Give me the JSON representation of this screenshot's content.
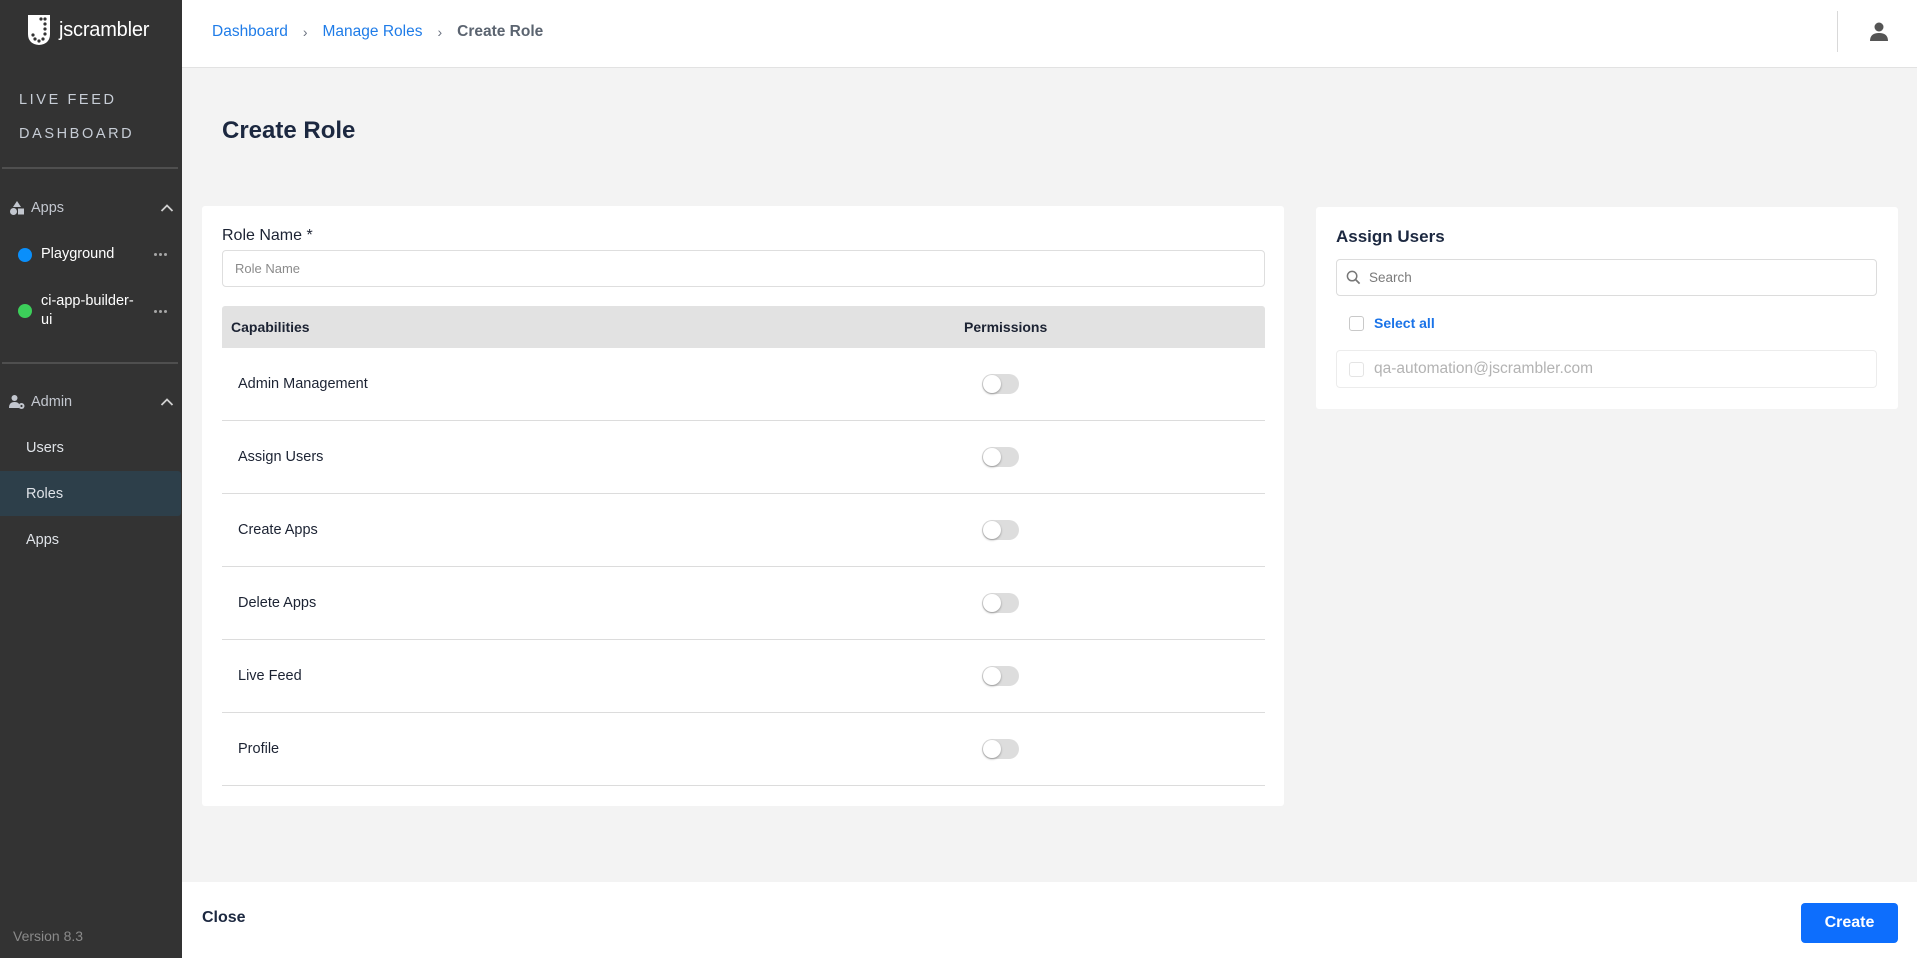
{
  "app": {
    "brand": "jscrambler",
    "version": "Version 8.3"
  },
  "sidebar": {
    "top_links": [
      {
        "label": "LIVE FEED"
      },
      {
        "label": "DASHBOARD"
      }
    ],
    "apps_section": {
      "label": "Apps",
      "expanded": true,
      "items": [
        {
          "label": "Playground",
          "color": "#0a8ffb"
        },
        {
          "label": "ci-app-builder-ui",
          "color": "#3ccf5a"
        }
      ]
    },
    "admin_section": {
      "label": "Admin",
      "expanded": true,
      "items": [
        {
          "label": "Users",
          "active": false
        },
        {
          "label": "Roles",
          "active": true
        },
        {
          "label": "Apps",
          "active": false
        }
      ]
    }
  },
  "header": {
    "breadcrumb": [
      {
        "label": "Dashboard"
      },
      {
        "label": "Manage Roles"
      },
      {
        "label": "Create Role"
      }
    ],
    "separator": "›",
    "user_icon": "user-icon"
  },
  "page": {
    "title": "Create Role"
  },
  "role_form": {
    "role_name_label": "Role Name *",
    "role_name_value": "",
    "role_name_placeholder": "Role Name",
    "table": {
      "columns": [
        "Capabilities",
        "Permissions"
      ],
      "rows": [
        {
          "capability": "Admin Management",
          "enabled": false
        },
        {
          "capability": "Assign Users",
          "enabled": false
        },
        {
          "capability": "Create Apps",
          "enabled": false
        },
        {
          "capability": "Delete Apps",
          "enabled": false
        },
        {
          "capability": "Live Feed",
          "enabled": false
        },
        {
          "capability": "Profile",
          "enabled": false
        }
      ]
    }
  },
  "assign_users": {
    "title": "Assign Users",
    "search_value": "",
    "search_placeholder": "Search",
    "select_all_label": "Select all",
    "users": [
      {
        "email": "qa-automation@jscrambler.com",
        "checked": false,
        "disabled": true
      }
    ]
  },
  "footer": {
    "close_label": "Close",
    "create_label": "Create"
  },
  "colors": {
    "sidebar_bg": "#333333",
    "active_nav_bg": "#2d3f4a",
    "link_blue": "#1f7ce8",
    "primary_button": "#0d6efd",
    "page_bg": "#f3f3f3"
  }
}
